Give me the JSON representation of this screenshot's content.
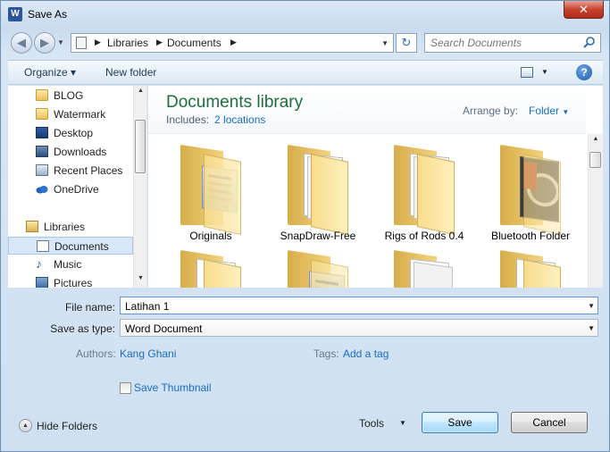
{
  "window": {
    "title": "Save As",
    "app_icon_letter": "W",
    "close_glyph": "✕"
  },
  "nav": {
    "back_glyph": "◀",
    "forward_glyph": "▶",
    "breadcrumbs": [
      "Libraries",
      "Documents"
    ],
    "refresh_glyph": "↻",
    "search_placeholder": "Search Documents"
  },
  "toolbar": {
    "organize_label": "Organize ▾",
    "new_folder_label": "New folder",
    "help_glyph": "?"
  },
  "sidebar": {
    "items": [
      {
        "label": "BLOG",
        "icon": "folder-icon"
      },
      {
        "label": "Watermark",
        "icon": "folder-icon"
      },
      {
        "label": "Desktop",
        "icon": "desktop-icon"
      },
      {
        "label": "Downloads",
        "icon": "downloads-icon"
      },
      {
        "label": "Recent Places",
        "icon": "recent-places-icon"
      },
      {
        "label": "OneDrive",
        "icon": "onedrive-icon"
      },
      {
        "label": "Libraries",
        "icon": "libraries-icon"
      },
      {
        "label": "Documents",
        "icon": "documents-icon"
      },
      {
        "label": "Music",
        "icon": "music-icon"
      },
      {
        "label": "Pictures",
        "icon": "pictures-icon"
      }
    ],
    "selected": "Documents"
  },
  "library": {
    "title": "Documents library",
    "includes_label": "Includes:",
    "includes_link": "2 locations",
    "arrange_label": "Arrange by:",
    "arrange_value": "Folder"
  },
  "folders": [
    {
      "name": "Originals",
      "thumb": "document-thumbnail"
    },
    {
      "name": "SnapDraw-Free",
      "thumb": "paper-thumbnail"
    },
    {
      "name": "Rigs of Rods 0.4",
      "thumb": "paper-thumbnail"
    },
    {
      "name": "Bluetooth Folder",
      "thumb": "bluetooth-thumbnail"
    },
    {
      "name": "",
      "thumb": "paper-thumbnail"
    },
    {
      "name": "",
      "thumb": "document-thumbnail"
    },
    {
      "name": "",
      "thumb": "paper-thumbnail"
    },
    {
      "name": "",
      "thumb": "paper-thumbnail"
    }
  ],
  "form": {
    "file_name_label": "File name:",
    "file_name_value": "Latihan 1",
    "save_type_label": "Save as type:",
    "save_type_value": "Word Document",
    "authors_label": "Authors:",
    "authors_value": "Kang Ghani",
    "tags_label": "Tags:",
    "tags_value": "Add a tag",
    "thumbnail_label": "Save Thumbnail"
  },
  "footer": {
    "hide_folders_label": "Hide Folders",
    "tools_label": "Tools",
    "save_label": "Save",
    "cancel_label": "Cancel"
  }
}
